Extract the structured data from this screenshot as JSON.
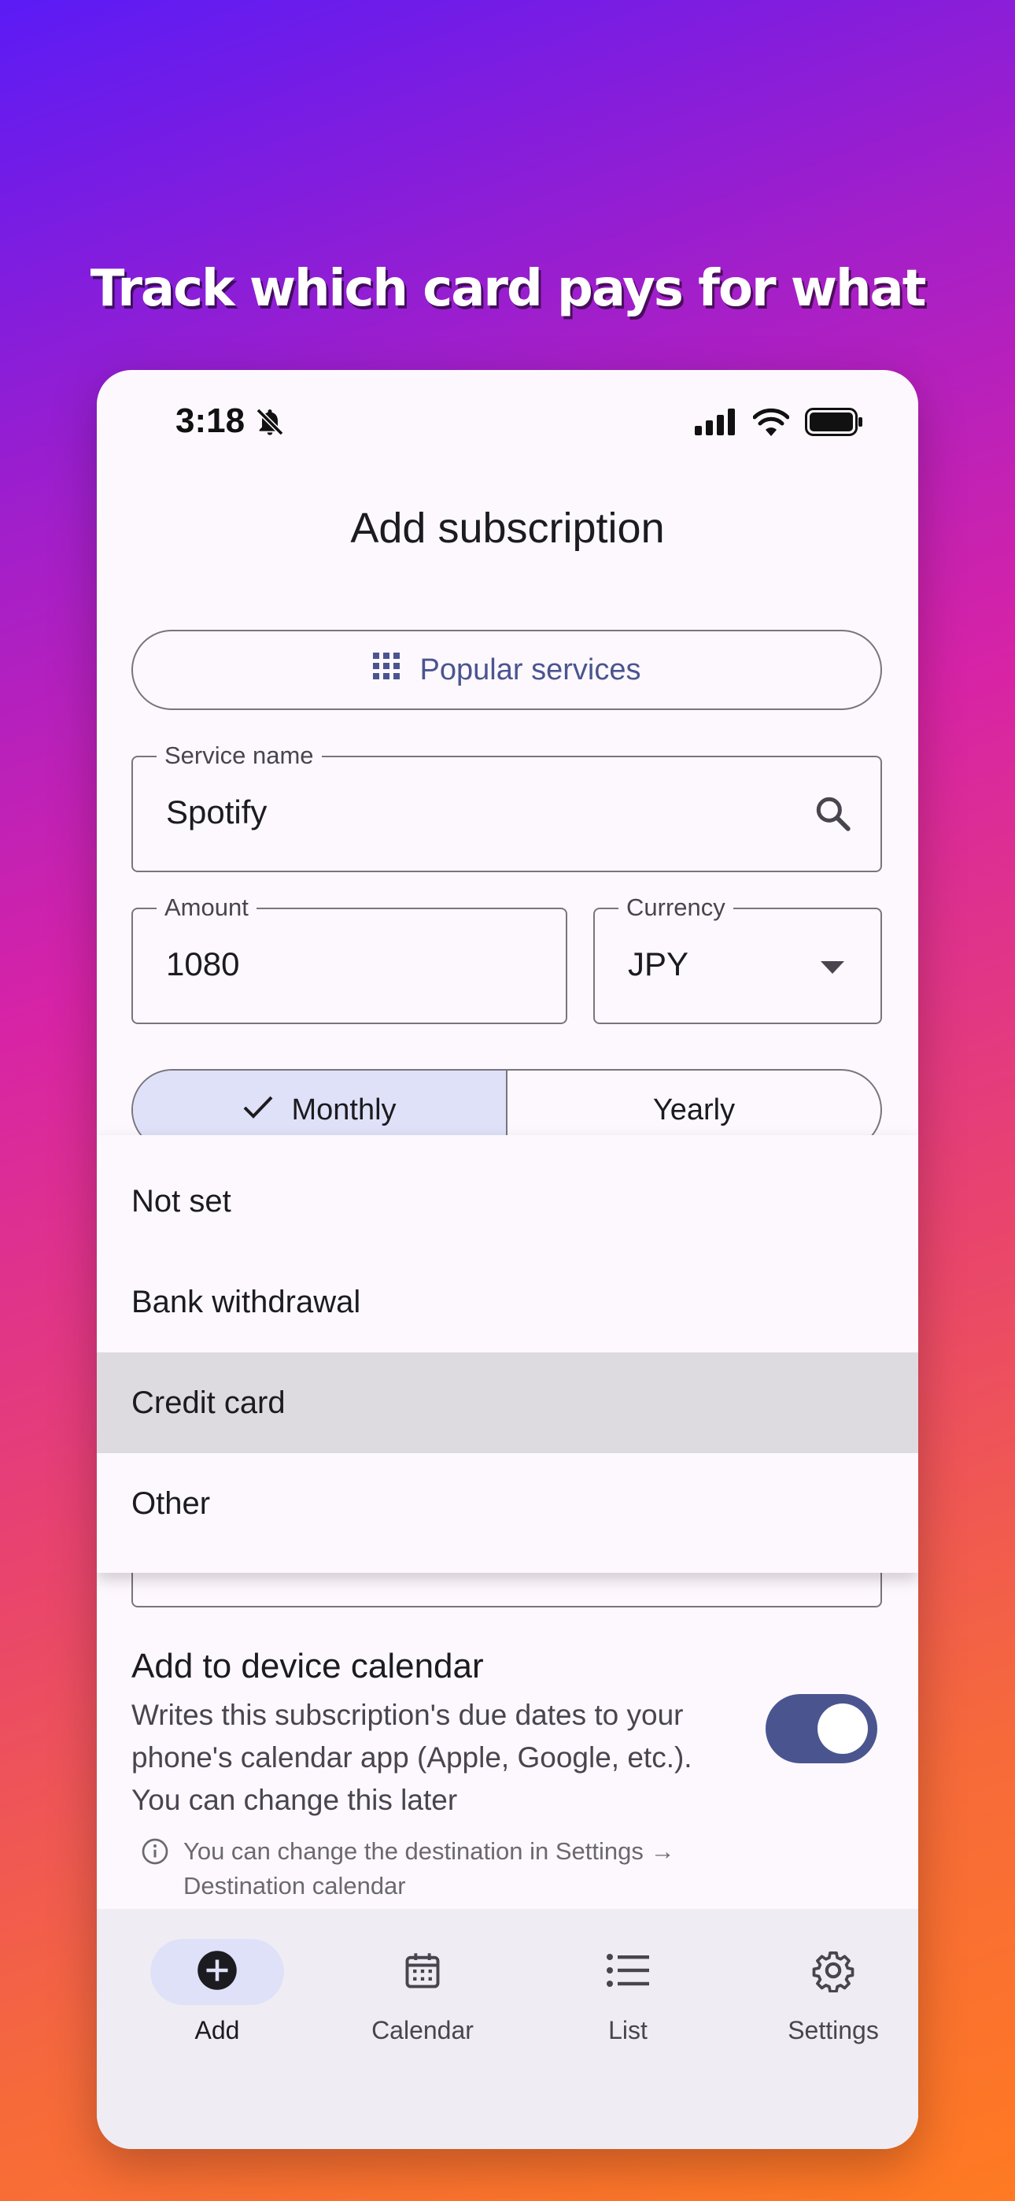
{
  "headline": "Track which card pays for what",
  "status": {
    "time": "3:18"
  },
  "screen_title": "Add subscription",
  "popular_services_label": "Popular services",
  "service_name": {
    "label": "Service name",
    "value": "Spotify"
  },
  "amount": {
    "label": "Amount",
    "value": "1080"
  },
  "currency": {
    "label": "Currency",
    "value": "JPY"
  },
  "billing_cycle": {
    "monthly": "Monthly",
    "yearly": "Yearly",
    "selected": "Monthly"
  },
  "payment_menu": {
    "items": [
      "Not set",
      "Bank withdrawal",
      "Credit card",
      "Other"
    ],
    "highlighted": "Credit card"
  },
  "calendar_option": {
    "title": "Add to device calendar",
    "description": "Writes this subscription's due dates to your phone's calendar app (Apple, Google, etc.). You can change this later",
    "enabled": true,
    "info": "You can change the destination in Settings → Destination calendar"
  },
  "nav": {
    "add": "Add",
    "calendar": "Calendar",
    "list": "List",
    "settings": "Settings",
    "active": "Add"
  },
  "colors": {
    "accent": "#4a5590",
    "selected_bg": "#dfe1f9",
    "surface": "#fdf8fd",
    "nav_bg": "#efedf3"
  }
}
